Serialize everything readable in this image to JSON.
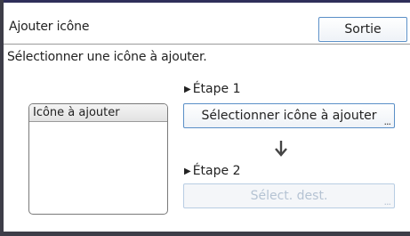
{
  "window": {
    "title": "Ajouter icône",
    "exit_label": "Sortie"
  },
  "instruction": "Sélectionner une icône à ajouter.",
  "icon_list": {
    "header": "Icône à ajouter",
    "items": []
  },
  "steps": {
    "step1": {
      "label": "Étape 1",
      "button_label": "Sélectionner icône à ajouter",
      "ellipsis": "...",
      "enabled": true
    },
    "step2": {
      "label": "Étape 2",
      "button_label": "Sélect. dest.",
      "ellipsis": "...",
      "enabled": false
    }
  },
  "icons": {
    "step_marker": "right-triangle-icon",
    "flow_arrow": "arrow-down-icon"
  },
  "colors": {
    "button_border": "#5a8fc7",
    "disabled_text": "#b5c3d3",
    "frame": "#3d3d48"
  }
}
